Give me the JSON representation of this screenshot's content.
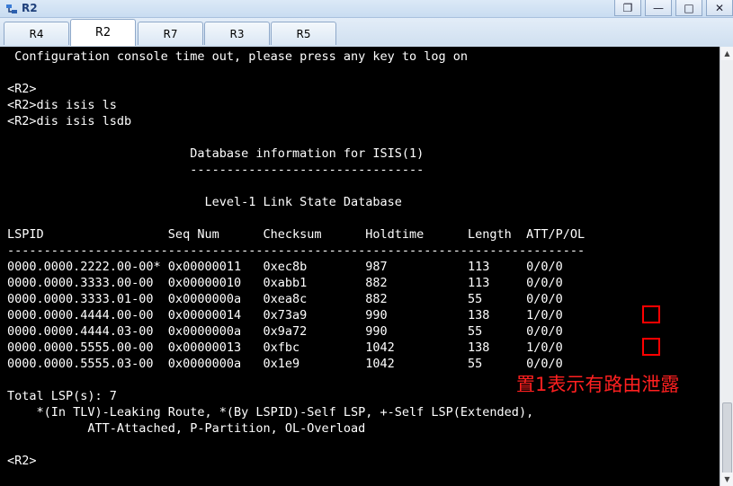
{
  "window": {
    "title": "R2",
    "controls": [
      "restore-down",
      "minimize",
      "maximize",
      "close"
    ],
    "control_glyphs": [
      "❐",
      "—",
      "□",
      "✕"
    ]
  },
  "tabs": [
    {
      "label": "R4",
      "active": false
    },
    {
      "label": "R2",
      "active": true
    },
    {
      "label": "R7",
      "active": false
    },
    {
      "label": "R3",
      "active": false
    },
    {
      "label": "R5",
      "active": false
    }
  ],
  "terminal": {
    "lines": [
      " Configuration console time out, please press any key to log on",
      "",
      "<R2>",
      "<R2>dis isis ls",
      "<R2>dis isis lsdb",
      "",
      "                         Database information for ISIS(1)",
      "                         --------------------------------",
      "",
      "                           Level-1 Link State Database",
      "",
      "LSPID                 Seq Num      Checksum      Holdtime      Length  ATT/P/OL",
      "-------------------------------------------------------------------------------",
      "0000.0000.2222.00-00* 0x00000011   0xec8b        987           113     0/0/0",
      "0000.0000.3333.00-00  0x00000010   0xabb1        882           113     0/0/0",
      "0000.0000.3333.01-00  0x0000000a   0xea8c        882           55      0/0/0",
      "0000.0000.4444.00-00  0x00000014   0x73a9        990           138     1/0/0",
      "0000.0000.4444.03-00  0x0000000a   0x9a72        990           55      0/0/0",
      "0000.0000.5555.00-00  0x00000013   0xfbc         1042          138     1/0/0",
      "0000.0000.5555.03-00  0x0000000a   0x1e9         1042          55      0/0/0",
      "",
      "Total LSP(s): 7",
      "    *(In TLV)-Leaking Route, *(By LSPID)-Self LSP, +-Self LSP(Extended),",
      "           ATT-Attached, P-Partition, OL-Overload",
      "",
      "<R2>"
    ]
  },
  "annotation": {
    "note": "置1表示有路由泄露",
    "color": "#ff0000"
  },
  "scrollbar": {
    "up_glyph": "▲",
    "down_glyph": "▼"
  }
}
